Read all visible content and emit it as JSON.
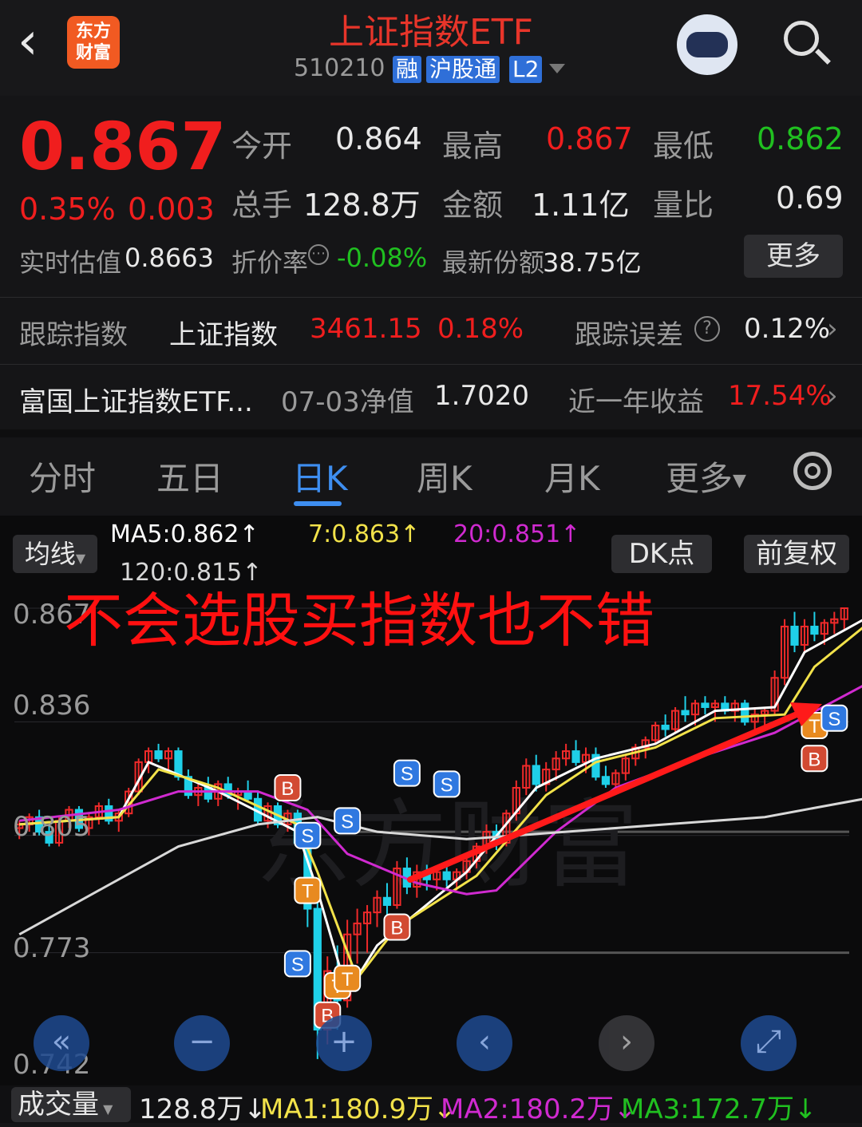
{
  "header": {
    "back_icon": "back-arrow-icon",
    "brand_line1": "东方",
    "brand_line2": "财富",
    "title": "上证指数ETF",
    "code": "510210",
    "tags": [
      "融",
      "沪股通",
      "L2"
    ],
    "avatar_icon": "robot-avatar-icon",
    "search_icon": "search-icon"
  },
  "quote": {
    "price": "0.867",
    "change_pct": "0.35%",
    "change": "0.003",
    "rows": [
      {
        "label1": "今开",
        "value1": "0.864",
        "label2": "最高",
        "value2": "0.867",
        "label3": "最低",
        "value3": "0.862"
      },
      {
        "label1": "总手",
        "value1": "128.8万",
        "label2": "金额",
        "value2": "1.11亿",
        "label3": "量比",
        "value3": "0.69"
      }
    ],
    "iopv_label": "实时估值",
    "iopv_value": "0.8663",
    "discount_label": "折价率",
    "discount_value": "-0.08%",
    "shares_label": "最新份额",
    "shares_value": "38.75亿",
    "more_button": "更多"
  },
  "tracking": {
    "label": "跟踪指数",
    "index_name": "上证指数",
    "index_value": "3461.15",
    "index_change": "0.18%",
    "error_label": "跟踪误差",
    "error_value": "0.12%"
  },
  "fund": {
    "name": "富国上证指数ETF...",
    "nav_label": "07-03净值",
    "nav_value": "1.7020",
    "return_label": "近一年收益",
    "return_value": "17.54%"
  },
  "tabs": [
    "分时",
    "五日",
    "日K",
    "周K",
    "月K",
    "更多"
  ],
  "active_tab": "日K",
  "chart_controls": {
    "ma_button": "均线",
    "ma5": "MA5:0.862",
    "ma7": "7:0.863",
    "ma20": "20:0.851",
    "ma120": "120:0.815",
    "up_arrow": "↑",
    "dk_button": "DK点",
    "adjust_button": "前复权",
    "overlay_text": "不会选股买指数也不错"
  },
  "chart_data": {
    "type": "candlestick",
    "y_ticks": [
      "0.867",
      "0.836",
      "0.805",
      "0.773",
      "0.742"
    ],
    "ylim": [
      0.742,
      0.867
    ],
    "watermark": "东方财富",
    "candles": [
      [
        0.807,
        0.809,
        0.804,
        0.808
      ],
      [
        0.808,
        0.811,
        0.806,
        0.81
      ],
      [
        0.81,
        0.812,
        0.805,
        0.806
      ],
      [
        0.806,
        0.808,
        0.802,
        0.803
      ],
      [
        0.803,
        0.81,
        0.802,
        0.809
      ],
      [
        0.809,
        0.813,
        0.807,
        0.812
      ],
      [
        0.812,
        0.813,
        0.806,
        0.807
      ],
      [
        0.807,
        0.811,
        0.805,
        0.81
      ],
      [
        0.81,
        0.814,
        0.808,
        0.813
      ],
      [
        0.813,
        0.815,
        0.808,
        0.809
      ],
      [
        0.809,
        0.812,
        0.806,
        0.811
      ],
      [
        0.811,
        0.818,
        0.81,
        0.817
      ],
      [
        0.817,
        0.826,
        0.816,
        0.825
      ],
      [
        0.825,
        0.829,
        0.822,
        0.828
      ],
      [
        0.828,
        0.83,
        0.825,
        0.826
      ],
      [
        0.826,
        0.829,
        0.823,
        0.828
      ],
      [
        0.828,
        0.829,
        0.82,
        0.821
      ],
      [
        0.821,
        0.823,
        0.815,
        0.816
      ],
      [
        0.816,
        0.819,
        0.813,
        0.818
      ],
      [
        0.818,
        0.821,
        0.814,
        0.815
      ],
      [
        0.815,
        0.82,
        0.813,
        0.819
      ],
      [
        0.819,
        0.821,
        0.815,
        0.816
      ],
      [
        0.816,
        0.818,
        0.812,
        0.817
      ],
      [
        0.817,
        0.82,
        0.814,
        0.815
      ],
      [
        0.815,
        0.817,
        0.808,
        0.809
      ],
      [
        0.809,
        0.814,
        0.807,
        0.813
      ],
      [
        0.813,
        0.814,
        0.807,
        0.808
      ],
      [
        0.808,
        0.812,
        0.806,
        0.811
      ],
      [
        0.811,
        0.812,
        0.802,
        0.803
      ],
      [
        0.803,
        0.805,
        0.78,
        0.785
      ],
      [
        0.785,
        0.788,
        0.744,
        0.752
      ],
      [
        0.752,
        0.772,
        0.748,
        0.768
      ],
      [
        0.768,
        0.775,
        0.752,
        0.76
      ],
      [
        0.76,
        0.782,
        0.758,
        0.778
      ],
      [
        0.778,
        0.785,
        0.77,
        0.781
      ],
      [
        0.781,
        0.786,
        0.773,
        0.784
      ],
      [
        0.784,
        0.79,
        0.78,
        0.788
      ],
      [
        0.788,
        0.792,
        0.783,
        0.786
      ],
      [
        0.786,
        0.798,
        0.785,
        0.796
      ],
      [
        0.796,
        0.799,
        0.789,
        0.791
      ],
      [
        0.791,
        0.797,
        0.788,
        0.795
      ],
      [
        0.795,
        0.797,
        0.79,
        0.793
      ],
      [
        0.793,
        0.796,
        0.79,
        0.795
      ],
      [
        0.795,
        0.797,
        0.791,
        0.793
      ],
      [
        0.793,
        0.796,
        0.79,
        0.795
      ],
      [
        0.795,
        0.8,
        0.793,
        0.798
      ],
      [
        0.798,
        0.803,
        0.796,
        0.802
      ],
      [
        0.802,
        0.808,
        0.8,
        0.806
      ],
      [
        0.806,
        0.808,
        0.801,
        0.803
      ],
      [
        0.803,
        0.812,
        0.802,
        0.811
      ],
      [
        0.811,
        0.82,
        0.809,
        0.818
      ],
      [
        0.818,
        0.826,
        0.816,
        0.824
      ],
      [
        0.824,
        0.827,
        0.817,
        0.819
      ],
      [
        0.819,
        0.825,
        0.817,
        0.823
      ],
      [
        0.823,
        0.828,
        0.82,
        0.826
      ],
      [
        0.826,
        0.83,
        0.824,
        0.828
      ],
      [
        0.828,
        0.831,
        0.824,
        0.825
      ],
      [
        0.825,
        0.829,
        0.822,
        0.827
      ],
      [
        0.827,
        0.829,
        0.82,
        0.821
      ],
      [
        0.821,
        0.824,
        0.818,
        0.819
      ],
      [
        0.819,
        0.823,
        0.817,
        0.822
      ],
      [
        0.822,
        0.827,
        0.82,
        0.826
      ],
      [
        0.826,
        0.83,
        0.824,
        0.829
      ],
      [
        0.829,
        0.832,
        0.826,
        0.831
      ],
      [
        0.831,
        0.836,
        0.83,
        0.835
      ],
      [
        0.835,
        0.838,
        0.832,
        0.834
      ],
      [
        0.834,
        0.84,
        0.833,
        0.839
      ],
      [
        0.839,
        0.843,
        0.836,
        0.838
      ],
      [
        0.838,
        0.842,
        0.835,
        0.841
      ],
      [
        0.841,
        0.843,
        0.838,
        0.84
      ],
      [
        0.84,
        0.842,
        0.836,
        0.841
      ],
      [
        0.841,
        0.843,
        0.838,
        0.839
      ],
      [
        0.839,
        0.842,
        0.836,
        0.841
      ],
      [
        0.841,
        0.842,
        0.835,
        0.836
      ],
      [
        0.836,
        0.84,
        0.834,
        0.838
      ],
      [
        0.838,
        0.84,
        0.835,
        0.839
      ],
      [
        0.839,
        0.85,
        0.838,
        0.848
      ],
      [
        0.848,
        0.864,
        0.846,
        0.862
      ],
      [
        0.862,
        0.866,
        0.855,
        0.857
      ],
      [
        0.857,
        0.864,
        0.855,
        0.862
      ],
      [
        0.862,
        0.866,
        0.858,
        0.86
      ],
      [
        0.86,
        0.864,
        0.857,
        0.863
      ],
      [
        0.863,
        0.866,
        0.86,
        0.864
      ],
      [
        0.864,
        0.867,
        0.861,
        0.867
      ]
    ],
    "ma_series": [
      {
        "name": "MA5",
        "color": "#ffffff",
        "points": [
          [
            0,
            0.808
          ],
          [
            10,
            0.81
          ],
          [
            13,
            0.825
          ],
          [
            20,
            0.817
          ],
          [
            28,
            0.806
          ],
          [
            30,
            0.79
          ],
          [
            33,
            0.762
          ],
          [
            36,
            0.775
          ],
          [
            45,
            0.795
          ],
          [
            52,
            0.818
          ],
          [
            58,
            0.826
          ],
          [
            64,
            0.83
          ],
          [
            70,
            0.839
          ],
          [
            76,
            0.84
          ],
          [
            79,
            0.855
          ],
          [
            85,
            0.864
          ]
        ]
      },
      {
        "name": "7",
        "color": "#f2e24a",
        "points": [
          [
            0,
            0.808
          ],
          [
            10,
            0.81
          ],
          [
            14,
            0.823
          ],
          [
            20,
            0.818
          ],
          [
            28,
            0.808
          ],
          [
            30,
            0.795
          ],
          [
            34,
            0.766
          ],
          [
            38,
            0.78
          ],
          [
            46,
            0.794
          ],
          [
            53,
            0.816
          ],
          [
            58,
            0.825
          ],
          [
            64,
            0.829
          ],
          [
            70,
            0.837
          ],
          [
            77,
            0.838
          ],
          [
            80,
            0.851
          ],
          [
            85,
            0.862
          ]
        ]
      },
      {
        "name": "20",
        "color": "#d02ad0",
        "points": [
          [
            0,
            0.809
          ],
          [
            10,
            0.812
          ],
          [
            16,
            0.817
          ],
          [
            24,
            0.817
          ],
          [
            29,
            0.812
          ],
          [
            33,
            0.8
          ],
          [
            40,
            0.792
          ],
          [
            45,
            0.789
          ],
          [
            48,
            0.79
          ],
          [
            54,
            0.806
          ],
          [
            60,
            0.818
          ],
          [
            68,
            0.826
          ],
          [
            76,
            0.833
          ],
          [
            85,
            0.846
          ]
        ]
      },
      {
        "name": "120",
        "color": "#d8d8d8",
        "points": [
          [
            0,
            0.778
          ],
          [
            8,
            0.79
          ],
          [
            16,
            0.802
          ],
          [
            24,
            0.808
          ],
          [
            30,
            0.81
          ],
          [
            36,
            0.806
          ],
          [
            45,
            0.804
          ],
          [
            55,
            0.806
          ],
          [
            65,
            0.808
          ],
          [
            75,
            0.81
          ],
          [
            85,
            0.815
          ]
        ]
      }
    ],
    "signals": [
      {
        "i": 27,
        "type": "B",
        "y": 0.818
      },
      {
        "i": 29,
        "type": "S",
        "y": 0.805
      },
      {
        "i": 29,
        "type": "T",
        "y": 0.79
      },
      {
        "i": 28,
        "type": "S",
        "y": 0.77
      },
      {
        "i": 32,
        "type": "T",
        "y": 0.764
      },
      {
        "i": 33,
        "type": "T",
        "y": 0.766
      },
      {
        "i": 31,
        "type": "B",
        "y": 0.756
      },
      {
        "i": 33,
        "type": "S",
        "y": 0.809
      },
      {
        "i": 39,
        "type": "S",
        "y": 0.822
      },
      {
        "i": 38,
        "type": "B",
        "y": 0.78
      },
      {
        "i": 43,
        "type": "S",
        "y": 0.819
      },
      {
        "i": 80,
        "type": "B",
        "y": 0.826
      },
      {
        "i": 80,
        "type": "T",
        "y": 0.835
      },
      {
        "i": 82,
        "type": "S",
        "y": 0.837
      }
    ]
  },
  "nav_icons": [
    "double-left-arrow-icon",
    "zoom-out-icon",
    "zoom-in-icon",
    "left-arrow-icon",
    "right-arrow-icon",
    "fullscreen-icon"
  ],
  "volume": {
    "label": "成交量",
    "value": "128.8万",
    "down": "↓",
    "ma1": "MA1:180.9万",
    "ma2": "MA2:180.2万",
    "ma3": "MA3:172.7万",
    "colors": {
      "ma1": "#f2e24a",
      "ma2": "#d02ad0",
      "ma3": "#20c020"
    }
  }
}
